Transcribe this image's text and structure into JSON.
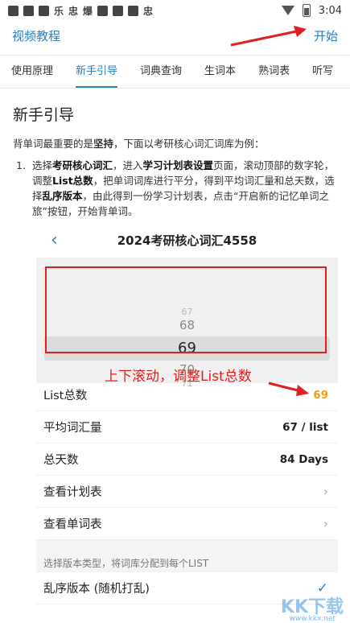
{
  "status": {
    "time": "3:04",
    "badge1": "乐",
    "badge2": "爆",
    "badge3": "忠"
  },
  "topbar": {
    "left_label": "视频教程",
    "right_label": "开始"
  },
  "tabs": [
    {
      "label": "使用原理",
      "active": false
    },
    {
      "label": "新手引导",
      "active": true
    },
    {
      "label": "词典查询",
      "active": false
    },
    {
      "label": "生词本",
      "active": false
    },
    {
      "label": "熟词表",
      "active": false
    },
    {
      "label": "听写",
      "active": false
    }
  ],
  "content": {
    "heading": "新手引导",
    "intro_pre": "背单词最重要的是",
    "intro_bold": "坚持",
    "intro_post": "，下面以考研核心词汇词库为例：",
    "step_num": "1.",
    "step_parts": [
      {
        "t": "选择",
        "b": false
      },
      {
        "t": "考研核心词汇",
        "b": true
      },
      {
        "t": "，进入",
        "b": false
      },
      {
        "t": "学习计划表设置",
        "b": true
      },
      {
        "t": "页面，滚动顶部的数字轮，调整",
        "b": false
      },
      {
        "t": "List总数",
        "b": true
      },
      {
        "t": "，把单词词库进行平分，得到平均词汇量和总天数，选择",
        "b": false
      },
      {
        "t": "乱序版本",
        "b": true
      },
      {
        "t": "，由此得到一份学习计划表，点击“开启新的记忆单词之旅”按钮，开始背单词。",
        "b": false
      }
    ]
  },
  "shot": {
    "title": "2024考研核心词汇4558",
    "picker": {
      "prev2": "67",
      "prev": "68",
      "selected": "69",
      "next": "70",
      "next2": "71"
    },
    "annotation": "上下滚动，调整List总数",
    "rows": [
      {
        "label": "List总数",
        "value": "69",
        "highlight": true
      },
      {
        "label": "平均词汇量",
        "value": "67 / list",
        "highlight": false
      },
      {
        "label": "总天数",
        "value": "84 Days",
        "highlight": false
      },
      {
        "label": "查看计划表",
        "value": "",
        "chevron": true
      },
      {
        "label": "查看单词表",
        "value": "",
        "chevron": true
      }
    ],
    "section_label": "选择版本类型，将词库分配到每个LIST",
    "option": "乱序版本 (随机打乱)"
  },
  "watermark": {
    "main": "KK下载",
    "sub": "www.kkx.net"
  },
  "colors": {
    "accent": "#2a7fc0",
    "red": "#e02020",
    "orange": "#f19a1c"
  }
}
